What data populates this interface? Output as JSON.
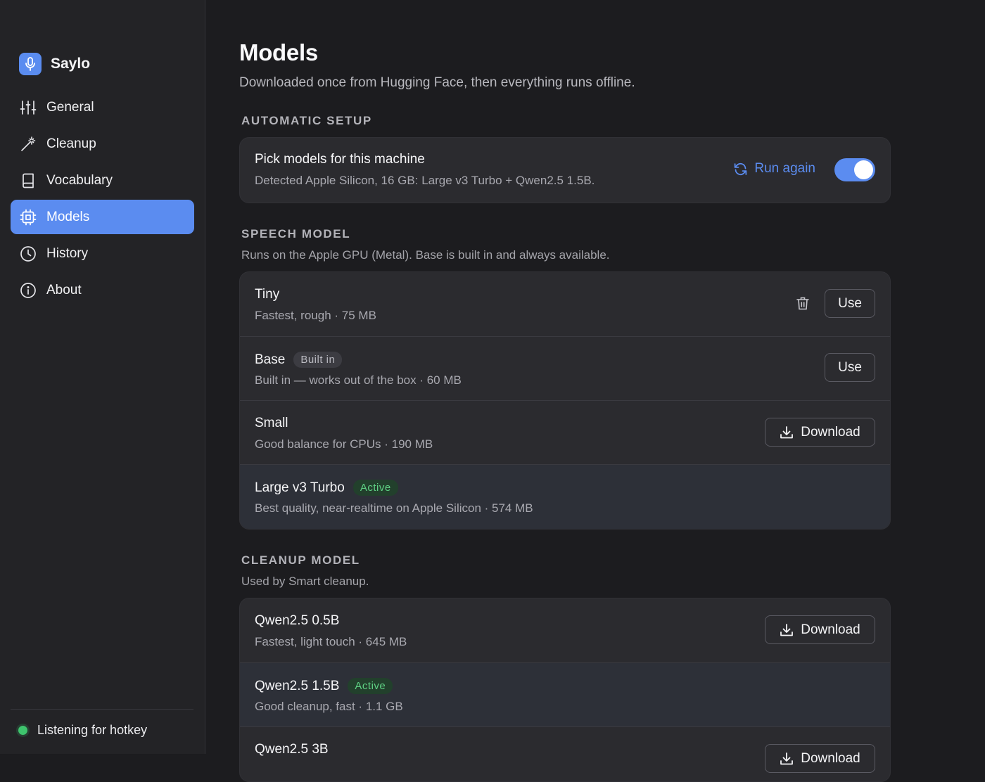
{
  "app": {
    "name": "Saylo"
  },
  "sidebar": {
    "items": [
      {
        "label": "General",
        "icon": "sliders-icon",
        "active": false
      },
      {
        "label": "Cleanup",
        "icon": "magic-wand-icon",
        "active": false
      },
      {
        "label": "Vocabulary",
        "icon": "book-icon",
        "active": false
      },
      {
        "label": "Models",
        "icon": "cpu-icon",
        "active": true
      },
      {
        "label": "History",
        "icon": "clock-icon",
        "active": false
      },
      {
        "label": "About",
        "icon": "info-icon",
        "active": false
      }
    ],
    "status": {
      "label": "Listening for hotkey",
      "color": "#3ec46d"
    }
  },
  "page": {
    "title": "Models",
    "subtitle": "Downloaded once from Hugging Face, then everything runs offline."
  },
  "automatic_setup": {
    "label": "AUTOMATIC SETUP",
    "title": "Pick models for this machine",
    "description": "Detected Apple Silicon, 16 GB: Large v3 Turbo + Qwen2.5 1.5B.",
    "run_again_label": "Run again",
    "toggle_on": true
  },
  "speech_model": {
    "label": "SPEECH MODEL",
    "description": "Runs on the Apple GPU (Metal). Base is built in and always available.",
    "models": [
      {
        "name": "Tiny",
        "detail": "Fastest, rough · 75 MB",
        "tag": "",
        "action": "Use",
        "deletable": true
      },
      {
        "name": "Base",
        "detail": "Built in — works out of the box · 60 MB",
        "tag": "Built in",
        "action": "Use",
        "deletable": false
      },
      {
        "name": "Small",
        "detail": "Good balance for CPUs · 190 MB",
        "tag": "",
        "action": "Download",
        "deletable": false
      },
      {
        "name": "Large v3 Turbo",
        "detail": "Best quality, near-realtime on Apple Silicon · 574 MB",
        "tag": "Active",
        "action": "",
        "deletable": false
      }
    ]
  },
  "cleanup_model": {
    "label": "CLEANUP MODEL",
    "description": "Used by Smart cleanup.",
    "models": [
      {
        "name": "Qwen2.5 0.5B",
        "detail": "Fastest, light touch · 645 MB",
        "tag": "",
        "action": "Download"
      },
      {
        "name": "Qwen2.5 1.5B",
        "detail": "Good cleanup, fast · 1.1 GB",
        "tag": "Active",
        "action": ""
      },
      {
        "name": "Qwen2.5 3B",
        "detail": "",
        "tag": "",
        "action": "Download"
      }
    ]
  },
  "colors": {
    "accent": "#5b8cf0",
    "active_tag": "#5fd184",
    "status_green": "#3ec46d"
  }
}
